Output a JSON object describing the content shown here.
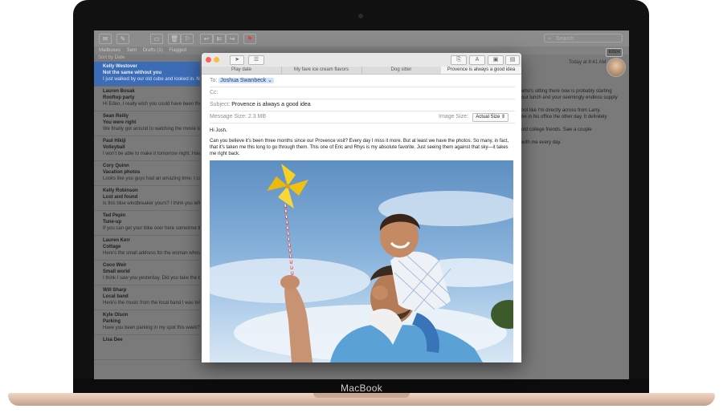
{
  "device": {
    "brand": "MacBook"
  },
  "mail": {
    "toolbar": {
      "search_placeholder": "Search"
    },
    "favorites": {
      "mailboxes": "Mailboxes",
      "inbox": "Inbox",
      "sent": "Sent",
      "drafts": "Drafts (1)",
      "flagged": "Flagged"
    },
    "sort_label": "Sort by Date",
    "messages": [
      {
        "from": "Kelly Westover",
        "subject": "Not the same without you",
        "preview": "I just walked by our old cube and looked in. Not sure when I'll get used to that ..."
      },
      {
        "from": "Lauren Bosak",
        "subject": "Rooftop party",
        "preview": "Hi Eden, I really wish you could have been there. Thanks for suggesting it..."
      },
      {
        "from": "Sean Reilly",
        "subject": "You were right",
        "preview": "We finally got around to watching the movie last night. Thanks for suggesting it. You..."
      },
      {
        "from": "Paul Hikiji",
        "subject": "Volleyball",
        "preview": "I won't be able to make it tomorrow night. Have you had a chance to go Fighting At..."
      },
      {
        "from": "Cory Quinn",
        "subject": "Vacation photos",
        "preview": "Looks like you guys had an amazing time. I can't believe you went out on a kayak again after what happened..."
      },
      {
        "from": "Kelly Robinson",
        "subject": "Lost and found",
        "preview": "Is this blue windbreaker yours? I think you left it at our house... some dessert. But see you this weekend..."
      },
      {
        "from": "Ted Pepin",
        "subject": "Tune-up",
        "preview": "If you can get your bike over here sometime this week, we'll have it ready by the weekend..."
      },
      {
        "from": "Lauren Kerr",
        "subject": "Cottage",
        "preview": "Here's the small address for the woman whose place we stayed at last summer, I'll ask..."
      },
      {
        "from": "Coco Weir",
        "subject": "Small world",
        "preview": "I think I saw you yesterday. Did you take the bus to the city? I could have..."
      },
      {
        "from": "Will Sharp",
        "subject": "Local band",
        "preview": "Here's the music from the local band I was telling you about. I like the mopey, shoe-gazing thing they do..."
      },
      {
        "from": "Kyle Olson",
        "subject": "Parking",
        "preview": "Have you been parking in my spot this week? I could have sworn I saw your car... Because that's when I..."
      },
      {
        "from": "Lisa Dee",
        "subject": "",
        "preview": ""
      }
    ],
    "reading": {
      "date": "Today at 8:41 AM",
      "body": "who's sitting there now is probably starting\nour lunch and your seemingly endless supply\n\nnot like I'm directly across from Larry.\nbe in his office the other day. It definitely\n\nold college friends. Saw a couple\n\nwith me every day."
    }
  },
  "compose": {
    "tabs": [
      "Play date",
      "My fave ice cream flavors",
      "Dog sitter",
      "Provence is always a good idea"
    ],
    "to_label": "To:",
    "to_value": "Joshua Swanbeck",
    "cc_label": "Cc:",
    "subject_label": "Subject:",
    "subject_value": "Provence is always a good idea",
    "size_label": "Message Size:",
    "size_value": "2.3 MB",
    "image_size_label": "Image Size:",
    "image_size_value": "Actual Size",
    "greeting": "Hi Josh,",
    "body": "Can you believe it's been three months since our Provence visit? Every day I miss it more. But at least we have the photos. So many, in fact, that it's taken me this long to go through them. This one of Eric and Rhys is my absolute favorite. Just seeing them against that sky—it takes me right back."
  },
  "colors": {
    "selection": "#3d6cb6",
    "close": "#fc605c",
    "minimize": "#fdbc40",
    "flag": "#e0443e"
  }
}
